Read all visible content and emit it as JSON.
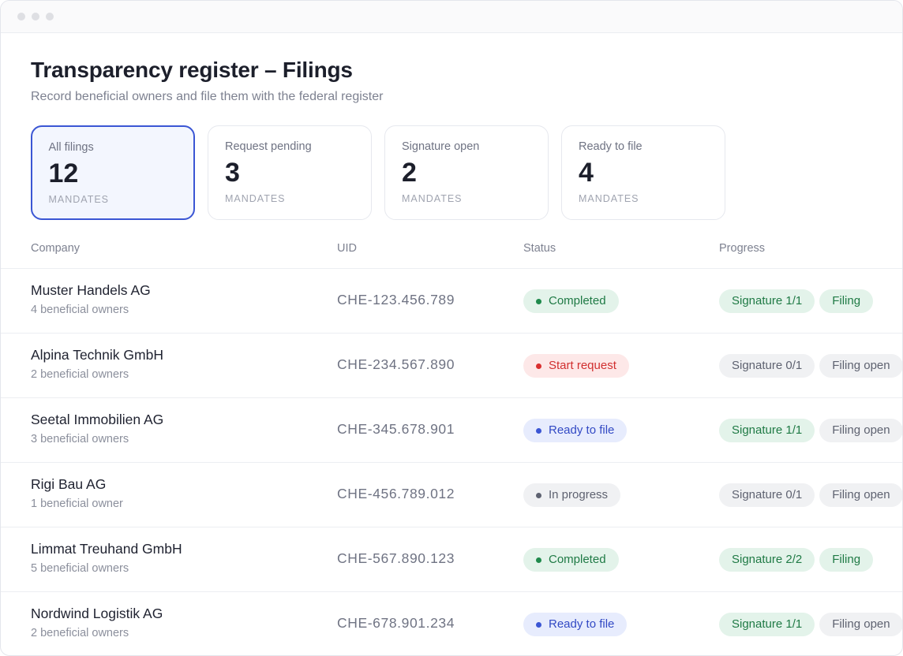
{
  "page": {
    "title": "Transparency register – Filings",
    "subtitle": "Record beneficial owners and file them with the federal register"
  },
  "summary_cards": [
    {
      "label": "All filings",
      "value": "12",
      "unit": "MANDATES",
      "active": true
    },
    {
      "label": "Request pending",
      "value": "3",
      "unit": "MANDATES",
      "active": false
    },
    {
      "label": "Signature open",
      "value": "2",
      "unit": "MANDATES",
      "active": false
    },
    {
      "label": "Ready to file",
      "value": "4",
      "unit": "MANDATES",
      "active": false
    }
  ],
  "table": {
    "columns": {
      "company": "Company",
      "uid": "UID",
      "status": "Status",
      "progress": "Progress"
    },
    "rows": [
      {
        "company": "Muster Handels AG",
        "owners": "4 beneficial owners",
        "uid": "CHE-123.456.789",
        "status": "Completed",
        "status_kind": "completed",
        "progress": [
          {
            "label": "Signature 1/1",
            "tone": "green"
          },
          {
            "label": "Filing",
            "tone": "green"
          }
        ]
      },
      {
        "company": "Alpina Technik GmbH",
        "owners": "2 beneficial owners",
        "uid": "CHE-234.567.890",
        "status": "Start request",
        "status_kind": "start",
        "progress": [
          {
            "label": "Signature 0/1",
            "tone": "grey"
          },
          {
            "label": "Filing open",
            "tone": "grey"
          }
        ]
      },
      {
        "company": "Seetal Immobilien AG",
        "owners": "3 beneficial owners",
        "uid": "CHE-345.678.901",
        "status": "Ready to file",
        "status_kind": "ready",
        "progress": [
          {
            "label": "Signature 1/1",
            "tone": "green"
          },
          {
            "label": "Filing open",
            "tone": "grey"
          }
        ]
      },
      {
        "company": "Rigi Bau AG",
        "owners": "1 beneficial owner",
        "uid": "CHE-456.789.012",
        "status": "In progress",
        "status_kind": "progress",
        "progress": [
          {
            "label": "Signature 0/1",
            "tone": "grey"
          },
          {
            "label": "Filing open",
            "tone": "grey"
          }
        ]
      },
      {
        "company": "Limmat Treuhand GmbH",
        "owners": "5 beneficial owners",
        "uid": "CHE-567.890.123",
        "status": "Completed",
        "status_kind": "completed",
        "progress": [
          {
            "label": "Signature 2/2",
            "tone": "green"
          },
          {
            "label": "Filing",
            "tone": "green"
          }
        ]
      },
      {
        "company": "Nordwind Logistik AG",
        "owners": "2 beneficial owners",
        "uid": "CHE-678.901.234",
        "status": "Ready to file",
        "status_kind": "ready",
        "progress": [
          {
            "label": "Signature 1/1",
            "tone": "green"
          },
          {
            "label": "Filing open",
            "tone": "grey"
          }
        ]
      }
    ]
  },
  "colors": {
    "accent": "#3b56d4",
    "completed": "#1f7a45",
    "start_request": "#d12f2f",
    "ready_to_file": "#3249c4",
    "in_progress": "#5e6270"
  }
}
